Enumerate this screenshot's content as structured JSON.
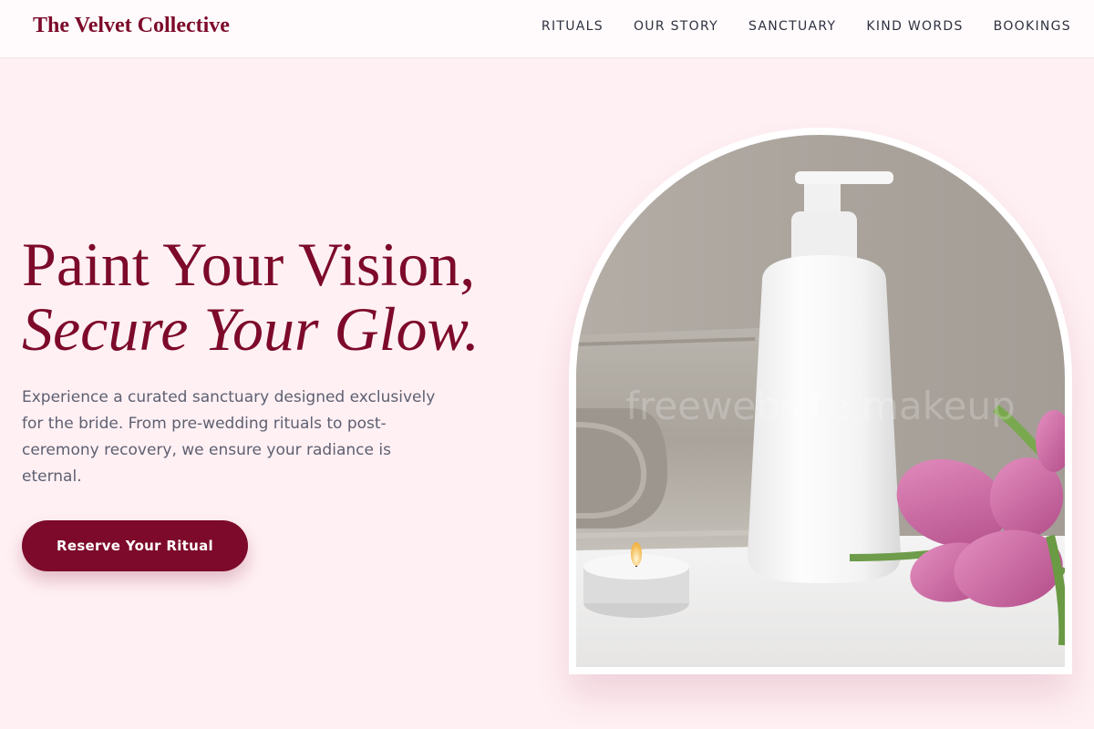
{
  "header": {
    "brand": "The Velvet Collective",
    "nav": [
      "RITUALS",
      "OUR STORY",
      "SANCTUARY",
      "KIND WORDS",
      "BOOKINGS"
    ]
  },
  "hero": {
    "title_line1": "Paint Your Vision,",
    "title_line2": "Secure Your Glow.",
    "description": "Experience a curated sanctuary designed exclusively for the bride. From pre-wedding rituals to post-ceremony recovery, we ensure your radiance is eternal.",
    "cta_label": "Reserve Your Ritual"
  },
  "image": {
    "subject": "spa-products-photo",
    "watermark": "freewebsite.makeup"
  },
  "colors": {
    "brand": "#7d0a2a",
    "background": "#fff0f4",
    "header_bg": "#fffbfc",
    "nav_text": "#2f3140",
    "body_text": "#5e6070"
  }
}
